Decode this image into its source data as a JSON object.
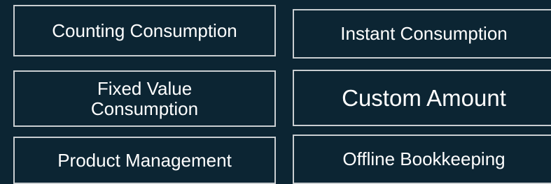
{
  "menu": {
    "counting_consumption": "Counting Consumption",
    "instant_consumption": "Instant Consumption",
    "fixed_value_consumption": "Fixed Value Consumption",
    "custom_amount": "Custom Amount",
    "product_management": "Product Management",
    "offline_bookkeeping": "Offline Bookkeeping"
  },
  "colors": {
    "background": "#0c2533",
    "tile_border": "#c9ced1",
    "text": "#ffffff"
  }
}
